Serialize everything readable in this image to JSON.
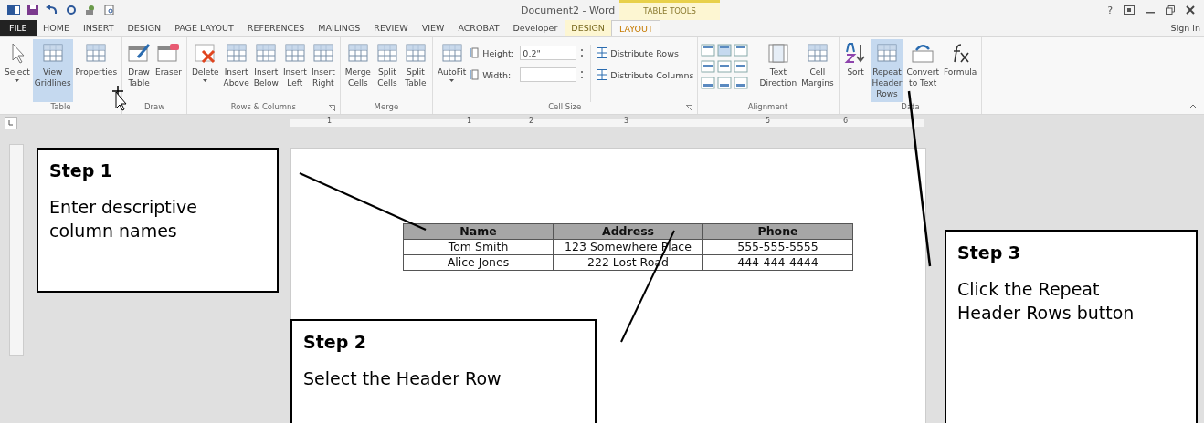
{
  "window": {
    "title": "Document2 - Word",
    "help": "?",
    "sign_in": "Sign in"
  },
  "context_group": {
    "label": "TABLE TOOLS"
  },
  "tabs": [
    {
      "label": "FILE",
      "kind": "file",
      "selected": false
    },
    {
      "label": "HOME",
      "kind": "tab",
      "selected": false
    },
    {
      "label": "INSERT",
      "kind": "tab",
      "selected": false
    },
    {
      "label": "DESIGN",
      "kind": "tab",
      "selected": false
    },
    {
      "label": "PAGE LAYOUT",
      "kind": "tab",
      "selected": false
    },
    {
      "label": "REFERENCES",
      "kind": "tab",
      "selected": false
    },
    {
      "label": "MAILINGS",
      "kind": "tab",
      "selected": false
    },
    {
      "label": "REVIEW",
      "kind": "tab",
      "selected": false
    },
    {
      "label": "VIEW",
      "kind": "tab",
      "selected": false
    },
    {
      "label": "ACROBAT",
      "kind": "tab",
      "selected": false
    },
    {
      "label": "Developer",
      "kind": "tab",
      "selected": false
    },
    {
      "label": "DESIGN",
      "kind": "context",
      "selected": false
    },
    {
      "label": "LAYOUT",
      "kind": "context",
      "selected": true
    }
  ],
  "ribbon": [
    {
      "name": "Table",
      "items": [
        {
          "kind": "button",
          "label": "Select",
          "dropdown": true,
          "selected": false
        },
        {
          "kind": "button",
          "label": "View Gridlines",
          "selected": true
        },
        {
          "kind": "button",
          "label": "Properties",
          "selected": false
        }
      ]
    },
    {
      "name": "Draw",
      "items": [
        {
          "kind": "button",
          "label": "Draw Table",
          "selected": false
        },
        {
          "kind": "button",
          "label": "Eraser",
          "selected": false
        }
      ]
    },
    {
      "name": "Rows & Columns",
      "launcher": true,
      "items": [
        {
          "kind": "button",
          "label": "Delete",
          "dropdown": true,
          "selected": false
        },
        {
          "kind": "button",
          "label": "Insert Above",
          "selected": false
        },
        {
          "kind": "button",
          "label": "Insert Below",
          "selected": false
        },
        {
          "kind": "button",
          "label": "Insert Left",
          "selected": false
        },
        {
          "kind": "button",
          "label": "Insert Right",
          "selected": false
        }
      ]
    },
    {
      "name": "Merge",
      "items": [
        {
          "kind": "button",
          "label": "Merge Cells",
          "selected": false
        },
        {
          "kind": "button",
          "label": "Split Cells",
          "selected": false
        },
        {
          "kind": "button",
          "label": "Split Table",
          "selected": false
        }
      ]
    },
    {
      "name": "Cell Size",
      "launcher": true,
      "items": [
        {
          "kind": "button",
          "label": "AutoFit",
          "dropdown": true,
          "selected": false
        },
        {
          "kind": "fields",
          "fields": [
            {
              "label": "Height:",
              "value": "0.2\""
            },
            {
              "label": "Width:"
            }
          ],
          "links": [
            "Distribute Rows",
            "Distribute Columns"
          ]
        }
      ]
    },
    {
      "name": "Alignment",
      "items": [
        {
          "kind": "align"
        },
        {
          "kind": "button",
          "label": "Text Direction",
          "selected": false
        },
        {
          "kind": "button",
          "label": "Cell Margins",
          "selected": false
        }
      ]
    },
    {
      "name": "Data",
      "items": [
        {
          "kind": "button",
          "label": "Sort",
          "selected": false
        },
        {
          "kind": "button",
          "label": "Repeat Header Rows",
          "selected": true
        },
        {
          "kind": "button",
          "label": "Convert to Text",
          "selected": false
        },
        {
          "kind": "button",
          "label": "Formula",
          "selected": false
        }
      ]
    }
  ],
  "ruler": {
    "numbers": [
      "1",
      "1",
      "2",
      "3",
      "5",
      "6"
    ]
  },
  "table": {
    "columns": [
      "Name",
      "Address",
      "Phone"
    ],
    "rows": [
      [
        "Tom Smith",
        "123 Somewhere Place",
        "555-555-5555"
      ],
      [
        "Alice Jones",
        "222 Lost Road",
        "444-444-4444"
      ]
    ]
  },
  "callouts": [
    {
      "title": "Step 1",
      "text": "Enter descriptive column names"
    },
    {
      "title": "Step 2",
      "text": "Select the Header Row"
    },
    {
      "title": "Step 3",
      "text": "Click the Repeat Header Rows button"
    }
  ]
}
